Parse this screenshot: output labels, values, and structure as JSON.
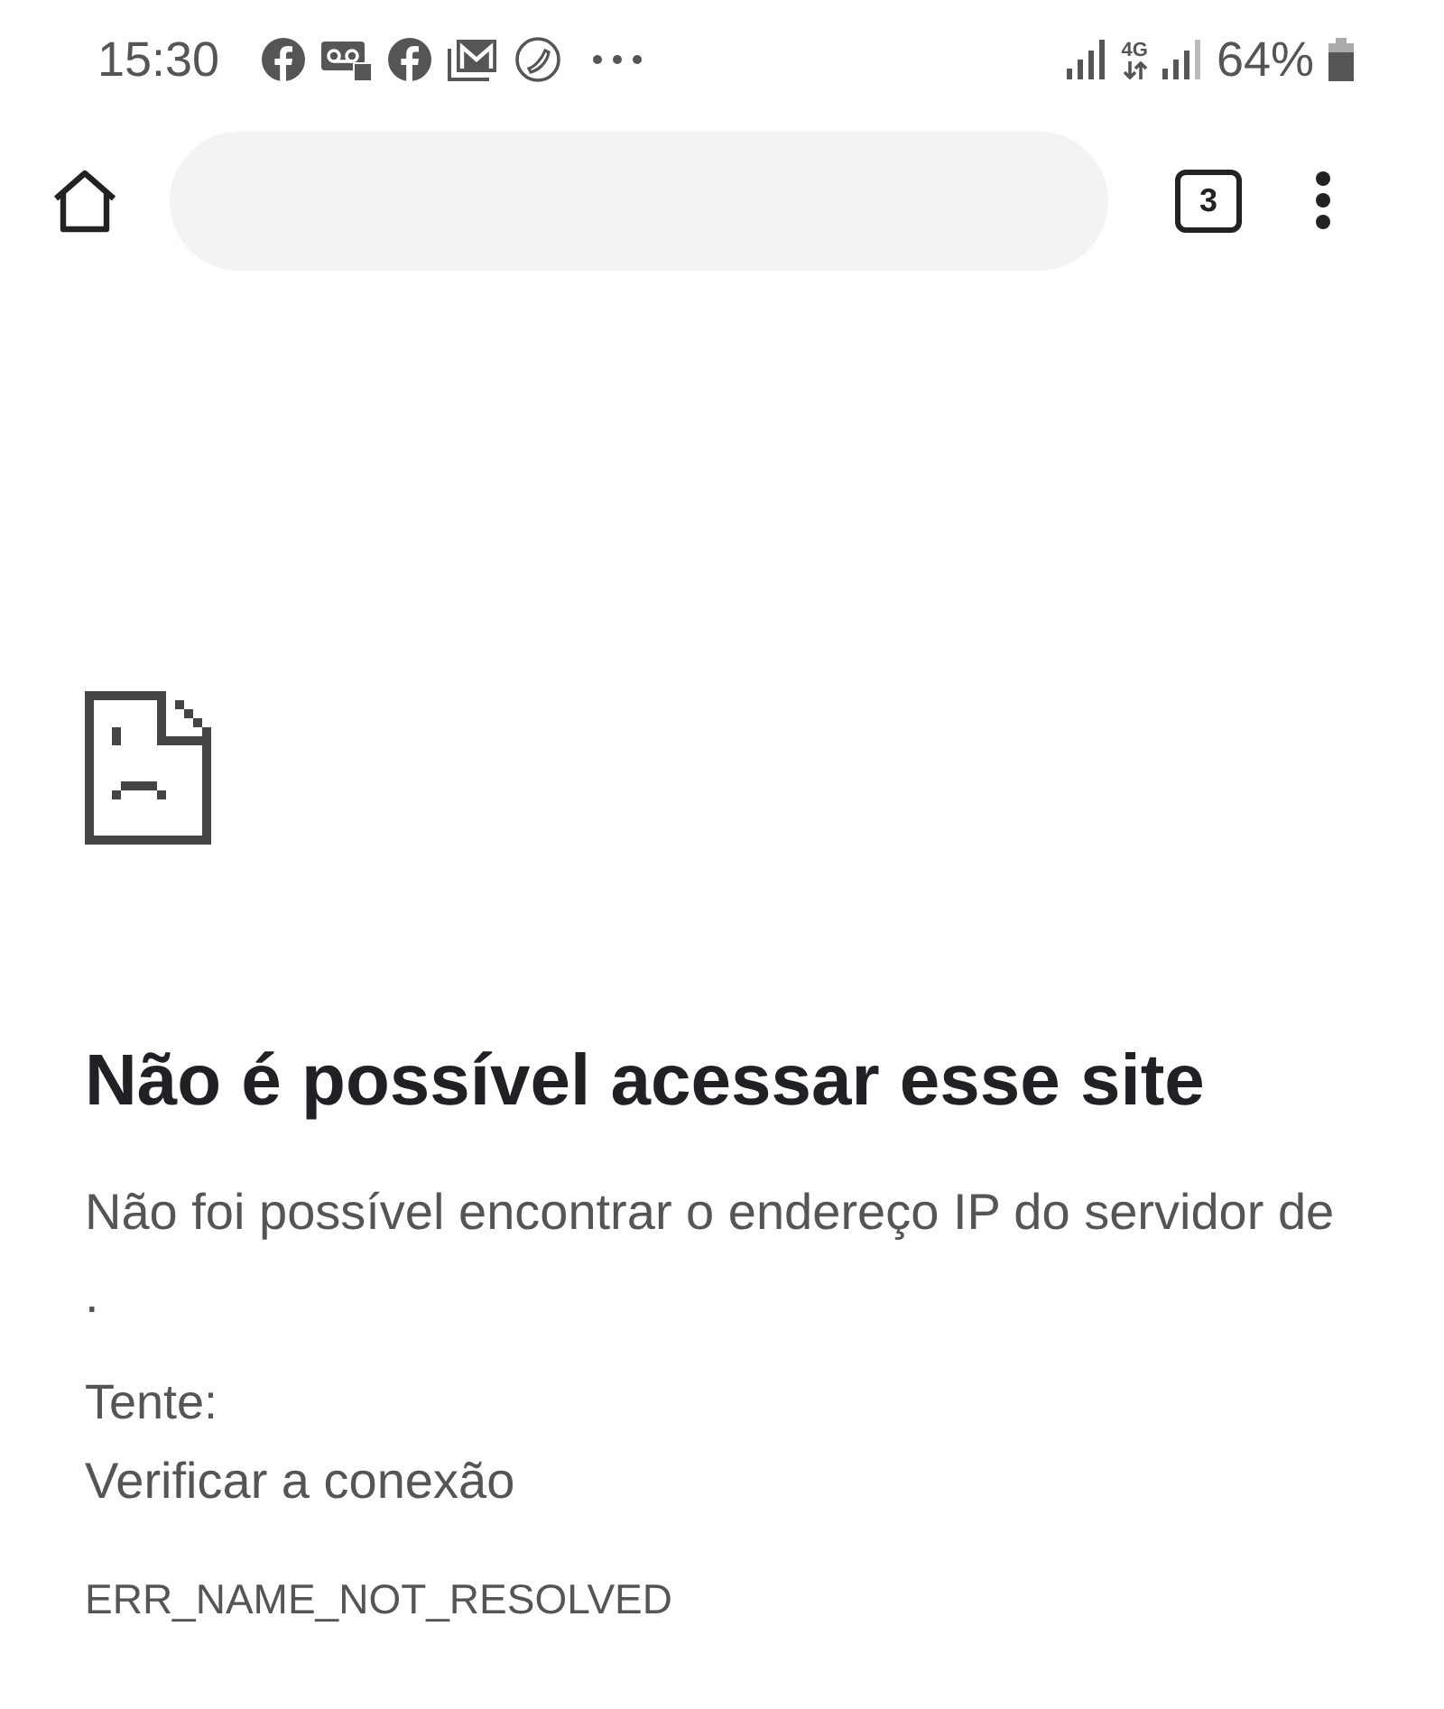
{
  "status_bar": {
    "time": "15:30",
    "network": "4G",
    "battery": "64%"
  },
  "toolbar": {
    "tab_count": "3"
  },
  "error": {
    "title": "Não é possível acessar esse site",
    "description": "Não foi possível encontrar o endereço IP do servidor de         .",
    "suggestion_label": "Tente:",
    "suggestions": [
      "Verificar a conexão"
    ],
    "code": "ERR_NAME_NOT_RESOLVED"
  }
}
